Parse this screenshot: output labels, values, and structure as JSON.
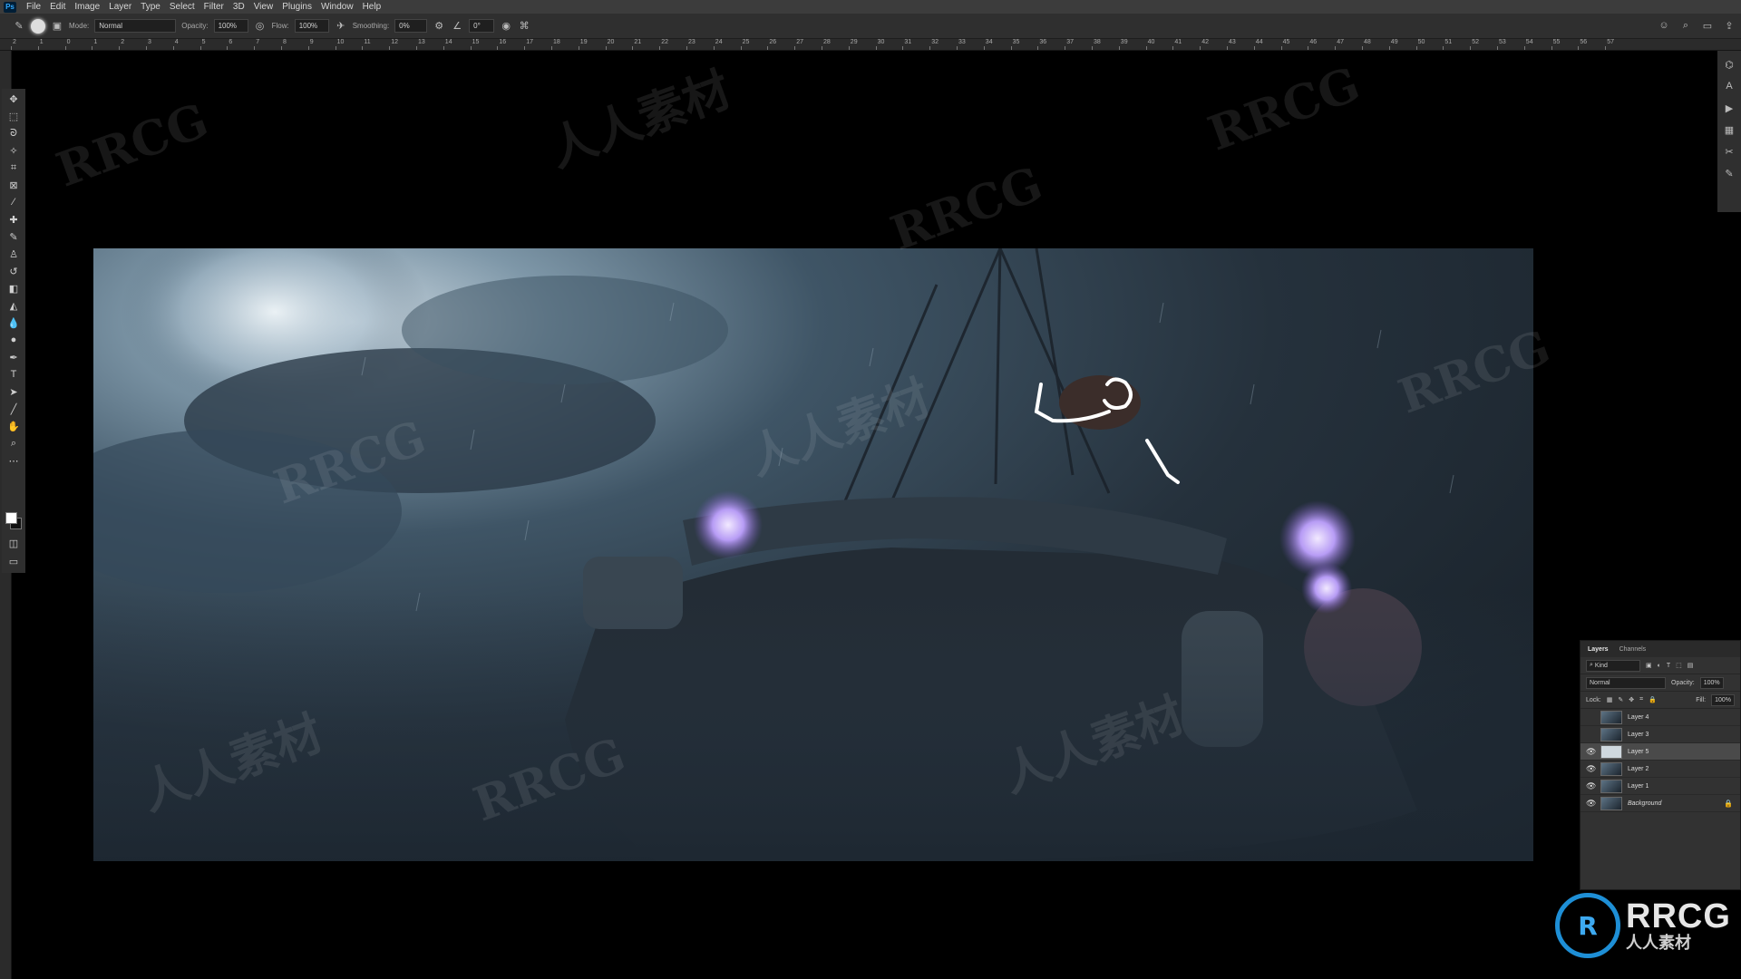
{
  "menu": [
    "File",
    "Edit",
    "Image",
    "Layer",
    "Type",
    "Select",
    "Filter",
    "3D",
    "View",
    "Plugins",
    "Window",
    "Help"
  ],
  "options": {
    "mode_label": "Mode:",
    "mode_value": "Normal",
    "opacity_label": "Opacity:",
    "opacity_value": "100%",
    "flow_label": "Flow:",
    "flow_value": "100%",
    "smoothing_label": "Smoothing:",
    "smoothing_value": "0%",
    "angle_value": "0°"
  },
  "ruler_labels": [
    "2",
    "1",
    "0",
    "1",
    "2",
    "3",
    "4",
    "5",
    "6",
    "7",
    "8",
    "9",
    "10",
    "11",
    "12",
    "13",
    "14",
    "15",
    "16",
    "17",
    "18",
    "19",
    "20",
    "21",
    "22",
    "23",
    "24",
    "25",
    "26",
    "27",
    "28",
    "29",
    "30",
    "31",
    "32",
    "33",
    "34",
    "35",
    "36",
    "37",
    "38",
    "39",
    "40",
    "41",
    "42",
    "43",
    "44",
    "45",
    "46",
    "47",
    "48",
    "49",
    "50",
    "51",
    "52",
    "53",
    "54",
    "55",
    "56",
    "57"
  ],
  "layers_panel": {
    "tabs": [
      "Layers",
      "Channels"
    ],
    "filter_value": "Kind",
    "blend_mode": "Normal",
    "opacity_label": "Opacity:",
    "opacity_value": "100%",
    "lock_label": "Lock:",
    "fill_label": "Fill:",
    "fill_value": "100%",
    "layers": [
      {
        "name": "Layer 4",
        "visible": false,
        "selected": false
      },
      {
        "name": "Layer 3",
        "visible": false,
        "selected": false
      },
      {
        "name": "Layer 5",
        "visible": true,
        "selected": true
      },
      {
        "name": "Layer 2",
        "visible": true,
        "selected": false
      },
      {
        "name": "Layer 1",
        "visible": true,
        "selected": false
      },
      {
        "name": "Background",
        "visible": true,
        "selected": false,
        "locked": true
      }
    ]
  },
  "watermark": {
    "latin": "RRCG",
    "cjk": "人人素材"
  },
  "logo": {
    "mark": "R",
    "title": "RRCG",
    "subtitle": "人人素材"
  },
  "colors": {
    "accent": "#31a8ff",
    "panel": "#323232",
    "canvas_sky": "#3f5566",
    "lantern": "#b79cf5"
  }
}
